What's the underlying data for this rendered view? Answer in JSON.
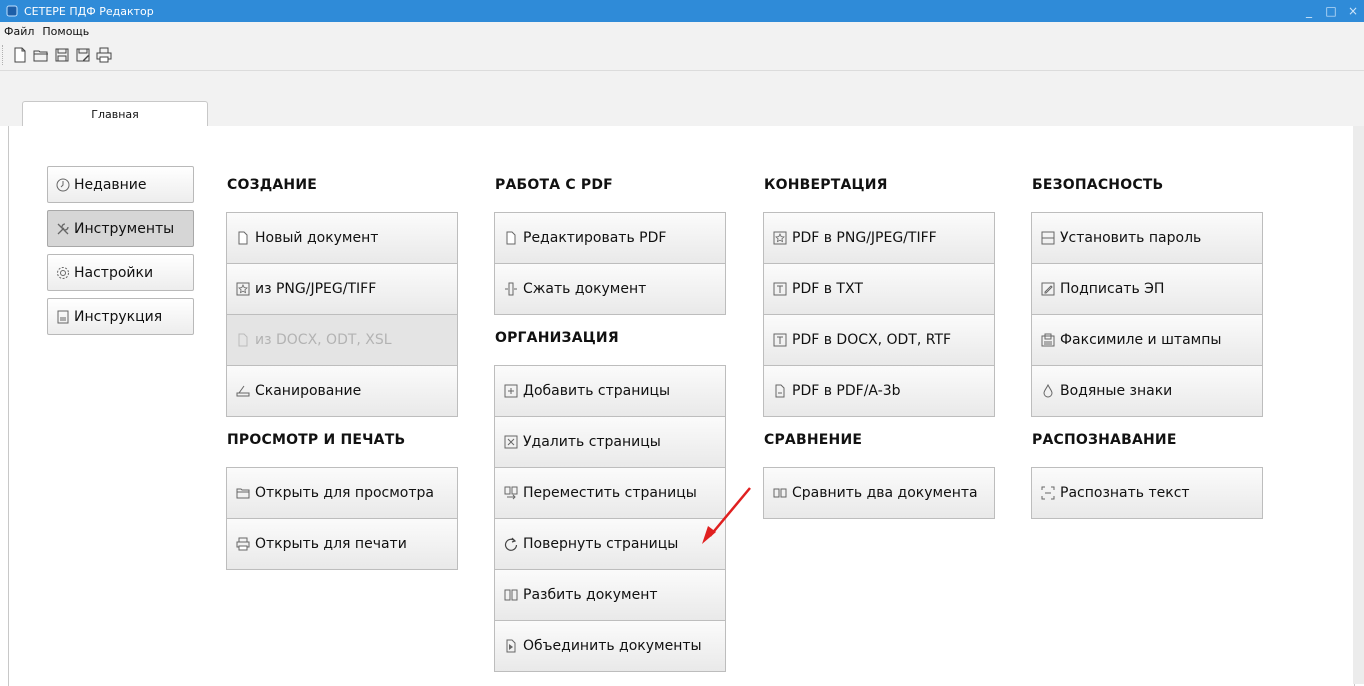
{
  "window": {
    "title": "СЕТЕРЕ ПДФ Редактор",
    "controls": [
      "_",
      "□",
      "×"
    ]
  },
  "menu": {
    "items": [
      "Файл",
      "Помощь"
    ]
  },
  "toolbar": {
    "icons": [
      "new-file-icon",
      "open-folder-icon",
      "save-icon",
      "save-as-icon",
      "print-icon"
    ]
  },
  "tabs": {
    "active": "Главная"
  },
  "nav": {
    "items": [
      {
        "label": "Недавние",
        "icon": "clock-icon",
        "active": false
      },
      {
        "label": "Инструменты",
        "icon": "tools-icon",
        "active": true
      },
      {
        "label": "Настройки",
        "icon": "gear-icon",
        "active": false
      },
      {
        "label": "Инструкция",
        "icon": "document-icon",
        "active": false
      }
    ]
  },
  "sections": {
    "creation": {
      "title": "СОЗДАНИЕ",
      "buttons": [
        {
          "label": "Новый документ",
          "icon": "page-icon",
          "disabled": false
        },
        {
          "label": "из PNG/JPEG/TIFF",
          "icon": "image-icon",
          "disabled": false
        },
        {
          "label": "из DOCX, ODT, XSL",
          "icon": "page-icon",
          "disabled": true
        },
        {
          "label": "Сканирование",
          "icon": "scanner-icon",
          "disabled": false
        }
      ]
    },
    "view_print": {
      "title": "ПРОСМОТР И ПЕЧАТЬ",
      "buttons": [
        {
          "label": "Открыть для просмотра",
          "icon": "folder-icon"
        },
        {
          "label": "Открыть для печати",
          "icon": "printer-icon"
        }
      ]
    },
    "pdf_work": {
      "title": "РАБОТА С PDF",
      "buttons": [
        {
          "label": "Редактировать PDF",
          "icon": "page-icon"
        },
        {
          "label": "Сжать документ",
          "icon": "compress-icon"
        }
      ]
    },
    "organization": {
      "title": "ОРГАНИЗАЦИЯ",
      "buttons": [
        {
          "label": "Добавить страницы",
          "icon": "add-page-icon"
        },
        {
          "label": "Удалить страницы",
          "icon": "delete-page-icon"
        },
        {
          "label": "Переместить страницы",
          "icon": "move-pages-icon"
        },
        {
          "label": "Повернуть страницы",
          "icon": "rotate-icon"
        },
        {
          "label": "Разбить документ",
          "icon": "split-icon"
        },
        {
          "label": "Объединить документы",
          "icon": "merge-icon"
        }
      ]
    },
    "conversion": {
      "title": "КОНВЕРТАЦИЯ",
      "buttons": [
        {
          "label": "PDF в PNG/JPEG/TIFF",
          "icon": "image-icon"
        },
        {
          "label": "PDF в TXT",
          "icon": "text-icon"
        },
        {
          "label": "PDF в DOCX, ODT, RTF",
          "icon": "text-icon"
        },
        {
          "label": "PDF в PDF/A-3b",
          "icon": "pdfa-icon"
        }
      ]
    },
    "comparison": {
      "title": "СРАВНЕНИЕ",
      "buttons": [
        {
          "label": "Сравнить два документа",
          "icon": "compare-icon"
        }
      ]
    },
    "security": {
      "title": "БЕЗОПАСНОСТЬ",
      "buttons": [
        {
          "label": "Установить пароль",
          "icon": "password-icon"
        },
        {
          "label": "Подписать ЭП",
          "icon": "sign-icon"
        },
        {
          "label": "Факсимиле и штампы",
          "icon": "stamp-icon"
        },
        {
          "label": "Водяные знаки",
          "icon": "water-drop-icon"
        }
      ]
    },
    "recognition": {
      "title": "РАСПОЗНАВАНИЕ",
      "buttons": [
        {
          "label": "Распознать текст",
          "icon": "ocr-icon"
        }
      ]
    }
  },
  "colors": {
    "titlebar": "#2f8bd8",
    "annotation_arrow": "#e02020"
  }
}
